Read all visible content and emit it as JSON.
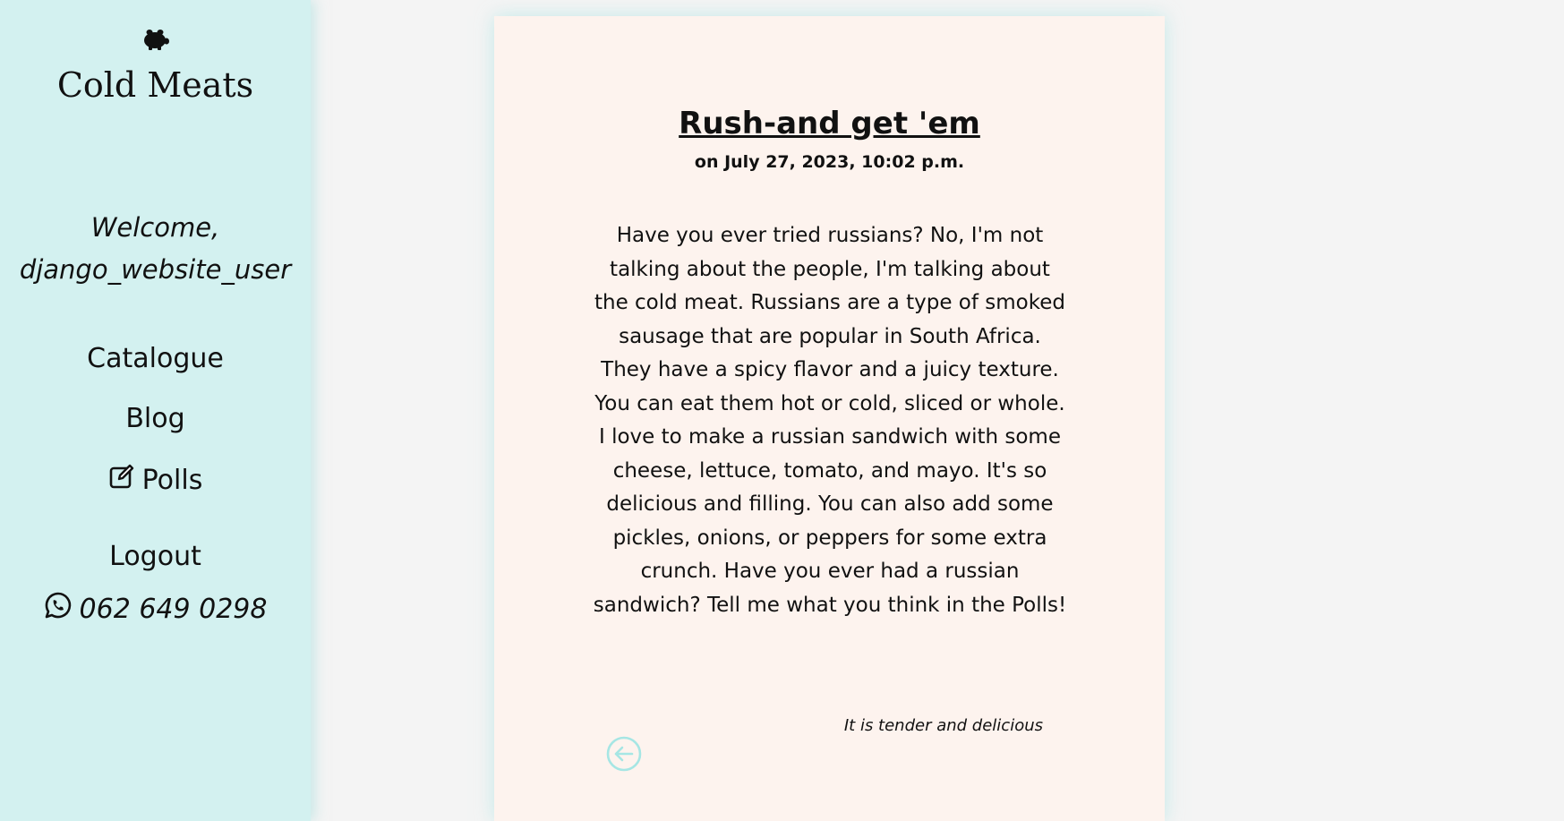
{
  "sidebar": {
    "logo_icon": "pig-icon",
    "brand": "Cold Meats",
    "welcome_line1": "Welcome,",
    "welcome_line2": "django_website_user",
    "nav": {
      "catalogue": "Catalogue",
      "blog": "Blog",
      "polls": "Polls",
      "polls_icon": "edit-icon",
      "logout": "Logout"
    },
    "phone": "062 649 0298",
    "phone_icon": "whatsapp-icon"
  },
  "post": {
    "title": "Rush-and get 'em",
    "date": "on July 27, 2023, 10:02 p.m.",
    "body": "Have you ever tried russians? No, I'm not talking about the people, I'm talking about the cold meat. Russians are a type of smoked sausage that are popular in South Africa. They have a spicy flavor and a juicy texture. You can eat them hot or cold, sliced or whole. I love to make a russian sandwich with some cheese, lettuce, tomato, and mayo. It's so delicious and filling. You can also add some pickles, onions, or peppers for some extra crunch. Have you ever had a russian sandwich? Tell me what you think in the Polls!",
    "tagline": "It is tender and delicious",
    "back_icon": "arrow-left-circle-icon"
  },
  "colors": {
    "sidebar_bg": "#d3f1f0",
    "page_bg": "#f4f4f4",
    "card_bg": "#fdf3ee",
    "accent": "#a6e6e4"
  }
}
